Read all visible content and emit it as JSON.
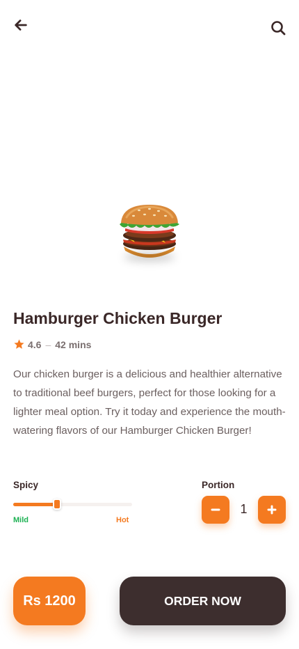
{
  "header": {
    "back_icon": "arrow-left-icon",
    "search_icon": "search-icon"
  },
  "product": {
    "image_icon": "burger-image",
    "title": "Hamburger Chicken Burger",
    "rating": "4.6",
    "separator": "–",
    "time": "42 mins",
    "description": "Our chicken burger is a delicious and healthier alternative to traditional beef burgers, perfect for those looking for a lighter meal option. Try it today and experience the mouth-watering flavors of our Hamburger Chicken Burger!"
  },
  "spicy": {
    "label": "Spicy",
    "min_label": "Mild",
    "max_label": "Hot",
    "level": 0.37
  },
  "portion": {
    "label": "Portion",
    "quantity": "1"
  },
  "footer": {
    "price": "Rs 1200",
    "order_label": "ORDER NOW"
  },
  "colors": {
    "accent": "#f47a20",
    "dark": "#3d2e2e",
    "mild": "#1bb152",
    "title": "#3a2727"
  }
}
